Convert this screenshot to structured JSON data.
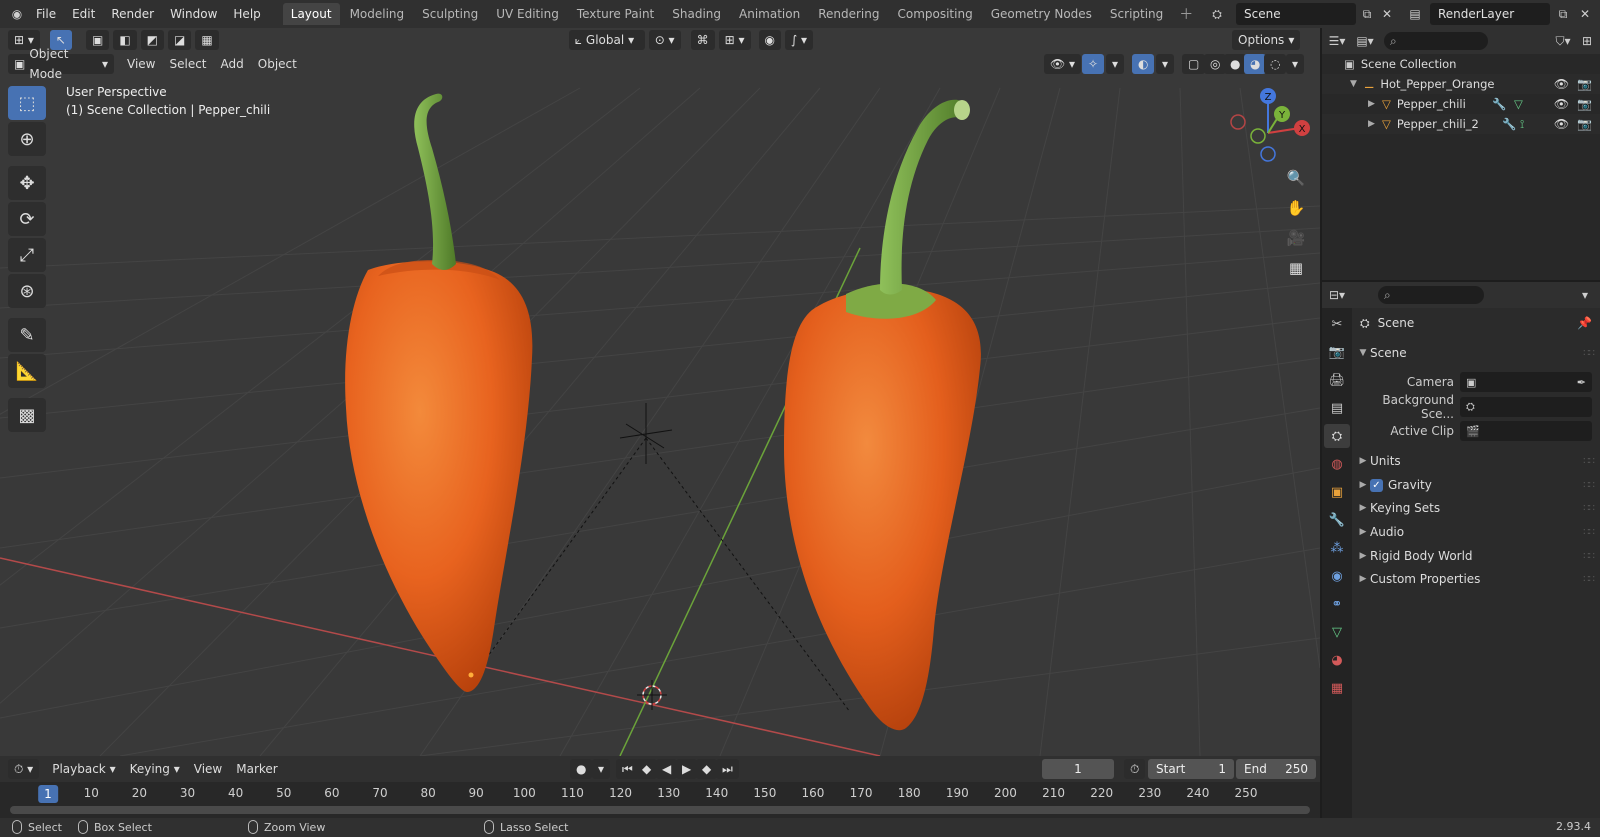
{
  "topbar": {
    "menus": [
      "File",
      "Edit",
      "Render",
      "Window",
      "Help"
    ],
    "workspaces": [
      "Layout",
      "Modeling",
      "Sculpting",
      "UV Editing",
      "Texture Paint",
      "Shading",
      "Animation",
      "Rendering",
      "Compositing",
      "Geometry Nodes",
      "Scripting"
    ],
    "active_workspace": "Layout",
    "scene_name": "Scene",
    "view_layer": "RenderLayer"
  },
  "viewport": {
    "transform_orientation": "Global",
    "options_label": "Options",
    "mode": "Object Mode",
    "menus": [
      "View",
      "Select",
      "Add",
      "Object"
    ],
    "view_name": "User Perspective",
    "collection_info": "(1) Scene Collection | Pepper_chili",
    "gizmo_axes": {
      "z": "Z",
      "y": "Y",
      "x": "X"
    },
    "colors": {
      "background": "#393939",
      "grid": "#444444",
      "x_axis": "#b34a4a",
      "y_axis": "#6ba33a",
      "pepper": "#e8631f",
      "stem": "#6c9a3a",
      "active_tool": "#4772b3"
    }
  },
  "timeline": {
    "menus": [
      "Playback",
      "Keying",
      "View",
      "Marker"
    ],
    "current_frame": "1",
    "start_label": "Start",
    "start_value": "1",
    "end_label": "End",
    "end_value": "250",
    "ticks": [
      "1",
      "10",
      "20",
      "30",
      "40",
      "50",
      "60",
      "70",
      "80",
      "90",
      "100",
      "110",
      "120",
      "130",
      "140",
      "150",
      "160",
      "170",
      "180",
      "190",
      "200",
      "210",
      "220",
      "230",
      "240",
      "250"
    ]
  },
  "statusbar": {
    "select": "Select",
    "box_select": "Box Select",
    "zoom_view": "Zoom View",
    "lasso_select": "Lasso Select",
    "version": "2.93.4"
  },
  "outliner": {
    "root": "Scene Collection",
    "collection": "Hot_Pepper_Orange",
    "objects": [
      "Pepper_chili",
      "Pepper_chili_2"
    ]
  },
  "properties": {
    "context": "Scene",
    "panel_title": "Scene",
    "fields": [
      {
        "label": "Camera"
      },
      {
        "label": "Background Sce..."
      },
      {
        "label": "Active Clip"
      }
    ],
    "subpanels": [
      "Units",
      "Gravity",
      "Keying Sets",
      "Audio",
      "Rigid Body World",
      "Custom Properties"
    ],
    "gravity_checked": true
  }
}
